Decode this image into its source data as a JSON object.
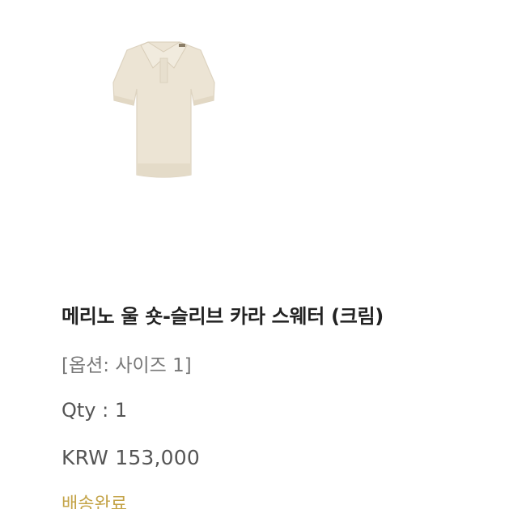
{
  "product": {
    "image_icon": "sweater-icon",
    "title": "메리노 울 숏-슬리브 카라 스웨터 (크림)",
    "option": "[옵션: 사이즈 1]",
    "qty": "Qty : 1",
    "price": "KRW 153,000",
    "status": "배송완료"
  },
  "colors": {
    "garment": "#ece4d4",
    "status_text": "#c4a449",
    "title_text": "#222222"
  }
}
